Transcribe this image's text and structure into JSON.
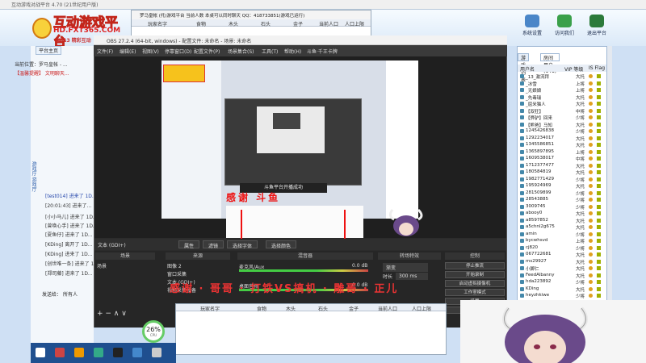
{
  "bg_app": {
    "title": "互动游戏对战平台 4.70 (21世纪用户版)",
    "logo_big": "互动游戏平台",
    "logo_url": "HD.FXT365.COM",
    "logo_slogan": "2013 精彩互动",
    "header_buttons": [
      {
        "label": "系统设置",
        "color": "#4a86c8"
      },
      {
        "label": "访问我们",
        "color": "#3aa04a"
      },
      {
        "label": "退出平台",
        "color": "#2b7a3a"
      }
    ],
    "tabs": [
      "平台主页",
      ""
    ],
    "left_lines": [
      "当前位置：罗马皇帐 - ...",
      "【温馨提醒】 文明聊天...",
      "[test014] 进来了 1D...",
      "[20:01:43] 进来了...",
      "[小小马儿] 进来了 1D...",
      "[曾唤心手] 进来了 1D...",
      "[夏鱼仔] 进来了 1D...",
      "[KDing] 离开了 1D...",
      "[KDing] 进来了 1D...",
      "[创世唯一条] 进来了 1D...",
      "[郑司藤] 进来了 1D..."
    ],
    "vertical_text": "游戏厅 游戏厅",
    "send_label": "发送给：",
    "send_target": "所有人"
  },
  "mid_window": {
    "title": "罗马皇帐 (托)游戏平台 当前人数 本桌可以同时聊天 QQ：418733851(游戏已运行)",
    "columns": [
      "玩家名字",
      "",
      "食物",
      "木头",
      "石头",
      "金子",
      "当前人口",
      "人口上限"
    ]
  },
  "right_panel": {
    "tabs": [
      "游戏列表",
      "房间用户(141)"
    ],
    "headers": [
      "用户名",
      "VIP 等级",
      "IS Flag"
    ],
    "users": [
      {
        "name": "_13_激流拜",
        "level": "大托"
      },
      {
        "name": "_冰雪",
        "level": "上将"
      },
      {
        "name": "_无娘娘",
        "level": "上将"
      },
      {
        "name": "_先毒瑞",
        "level": "大托"
      },
      {
        "name": "_屈米猫人",
        "level": "大托"
      },
      {
        "name": "【双狂】",
        "level": "中将"
      },
      {
        "name": "【骅驴】回来",
        "level": "少将"
      },
      {
        "name": "【熊爸】马知",
        "level": "大托"
      },
      {
        "name": "1245426838",
        "level": "少将"
      },
      {
        "name": "1292234017",
        "level": "大托"
      },
      {
        "name": "1345586851",
        "level": "大托"
      },
      {
        "name": "1365897895",
        "level": "上将"
      },
      {
        "name": "1609538017",
        "level": "中将"
      },
      {
        "name": "1712377477",
        "level": "大托"
      },
      {
        "name": "180584819",
        "level": "大托"
      },
      {
        "name": "1982771429",
        "level": "少将"
      },
      {
        "name": "195924969",
        "level": "大托"
      },
      {
        "name": "281509899",
        "level": "少将"
      },
      {
        "name": "28543885",
        "level": "少将"
      },
      {
        "name": "3009745",
        "level": "少将"
      },
      {
        "name": "abooy0",
        "level": "大托"
      },
      {
        "name": "a8597852",
        "level": "大托"
      },
      {
        "name": "a5chnl2g675",
        "level": "大托"
      },
      {
        "name": "amin",
        "level": "少将"
      },
      {
        "name": "bycwhsvd",
        "level": "上将"
      },
      {
        "name": "cj820",
        "level": "少将"
      },
      {
        "name": "067722681",
        "level": "大托"
      },
      {
        "name": "ms29927",
        "level": "大托"
      },
      {
        "name": "小脚仁",
        "level": "大托"
      },
      {
        "name": "FeedAlbanny",
        "level": "大托"
      },
      {
        "name": "hda223892",
        "level": "少将"
      },
      {
        "name": "KDing",
        "level": "大托"
      },
      {
        "name": "heyzhkiwe",
        "level": "少将"
      },
      {
        "name": "Dslngfl",
        "level": "少将"
      }
    ]
  },
  "obs": {
    "title": "OBS 27.2.4 (64-bit, windows) - 配置文件: 未命名 - 场景: 未命名",
    "menu": [
      "文件(F)",
      "编辑(E)",
      "视图(V)",
      "停靠窗口(D)",
      "配置文件(P)",
      "场景集合(S)",
      "工具(T)",
      "帮助(H)",
      "斗鱼·千王卡牌"
    ],
    "toast": "斗鱼平台开播成功",
    "preview_red_text": "感谢 斗鱼",
    "props_bar": [
      "文本 (GDI+)",
      "属性",
      "滤镜",
      "选择字体",
      "选择颜色"
    ],
    "docks": [
      "场景",
      "来源",
      "混音器",
      "转场特效",
      "控制"
    ],
    "scene_item": "场景",
    "sources": [
      "图像 2",
      "窗口采集",
      "文本 (GDI+)",
      "视频采集设备"
    ],
    "mixer": [
      {
        "name": "麦克风/Aux",
        "level": "0.0 dB"
      },
      {
        "name": "桌面音频",
        "level": "0.0 dB"
      }
    ],
    "transition": "渐变",
    "duration_label": "时长",
    "duration_value": "300 ms",
    "controls": [
      "停止推流",
      "开始录制",
      "启动虚拟摄像机",
      "工作室模式",
      "设置",
      "退出"
    ],
    "scroll_text": "感谢 · 哥哥 · 打铁VS搞机 · 雕哥 · 正儿"
  },
  "lower_window": {
    "columns": [
      "玩家名字",
      "食物",
      "木头",
      "石头",
      "金子",
      "当前人口",
      "人口上限"
    ]
  },
  "percent_badge": {
    "value": "26%",
    "label": "CPU"
  }
}
